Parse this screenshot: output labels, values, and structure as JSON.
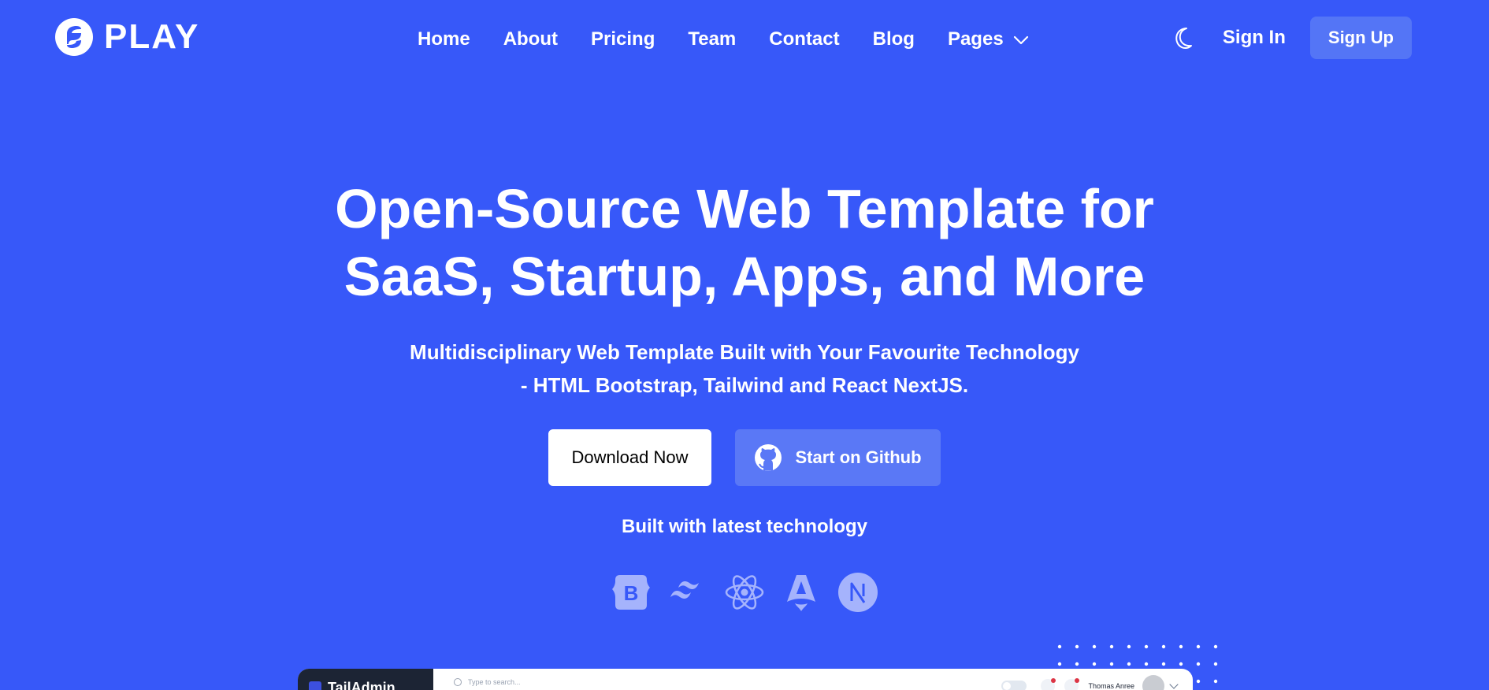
{
  "brand": {
    "name": "PLAY"
  },
  "nav": {
    "items": [
      "Home",
      "About",
      "Pricing",
      "Team",
      "Contact",
      "Blog"
    ],
    "pages_label": "Pages"
  },
  "header": {
    "signin": "Sign In",
    "signup": "Sign Up"
  },
  "hero": {
    "title_line1": "Open-Source Web Template for",
    "title_line2": "SaaS, Startup, Apps, and More",
    "subtitle_line1": "Multidisciplinary Web Template Built with Your Favourite Technology",
    "subtitle_line2": "- HTML Bootstrap, Tailwind and React NextJS.",
    "primary_button": "Download Now",
    "secondary_button": "Start on Github",
    "built_with": "Built with latest technology",
    "tech_icons": [
      "bootstrap-icon",
      "tailwind-icon",
      "react-icon",
      "astro-icon",
      "nextjs-icon"
    ]
  },
  "preview": {
    "brand": "TailAdmin",
    "search_placeholder": "Type to search...",
    "user_name": "Thomas Anree"
  },
  "colors": {
    "background": "#3758f9",
    "signup_bg": "#5475f6",
    "secondary_btn_bg": "#5a78f6"
  }
}
